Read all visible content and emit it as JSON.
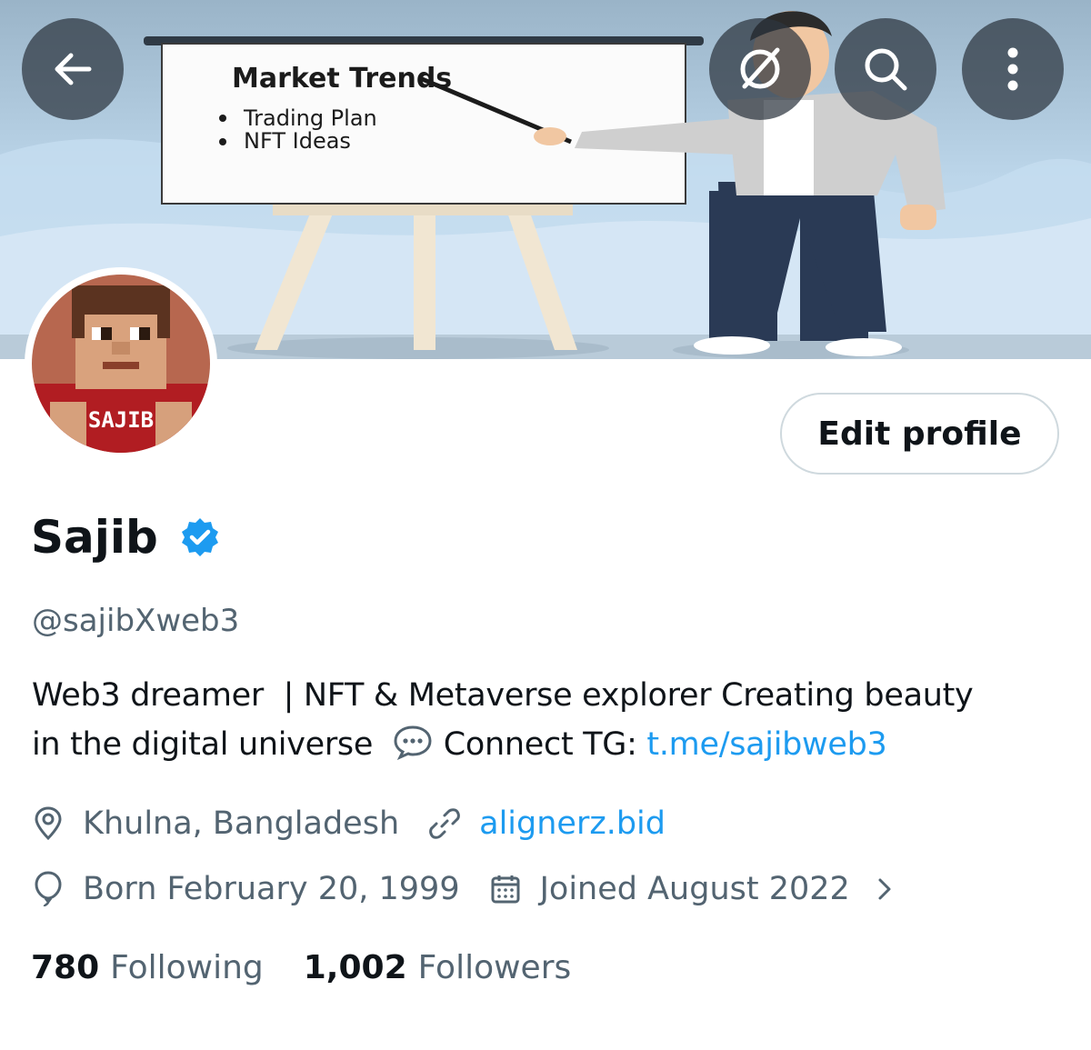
{
  "banner": {
    "board_title": "Market Trends",
    "board_items": [
      "Trading Plan",
      "NFT Ideas"
    ]
  },
  "header": {
    "back_icon": "arrow-left-icon",
    "grok_icon": "grok-icon",
    "search_icon": "search-icon",
    "more_icon": "more-vertical-icon"
  },
  "avatar": {
    "shirt_text": "SAJIB"
  },
  "edit_profile_label": "Edit profile",
  "profile": {
    "name": "Sajib",
    "handle": "@sajibXweb3",
    "verified": true,
    "bio_line1": "Web3 dreamer  | NFT & Metaverse explorer Creating beauty",
    "bio_line2_pre": "in the digital universe",
    "bio_line2_mid": " Connect TG: ",
    "bio_link": "t.me/sajibweb3",
    "location": "Khulna, Bangladesh",
    "website": "alignerz.bid",
    "born": "Born February 20, 1999",
    "joined": "Joined August 2022"
  },
  "stats": {
    "following_count": "780",
    "following_label": "Following",
    "followers_count": "1,002",
    "followers_label": "Followers"
  },
  "colors": {
    "accent": "#1d9bf0",
    "secondary_text": "#536471",
    "primary_text": "#0f1419",
    "border": "#cfd9de"
  }
}
